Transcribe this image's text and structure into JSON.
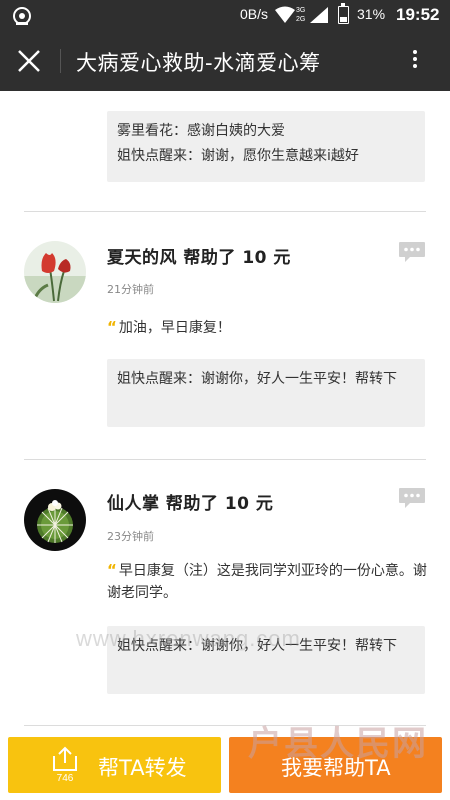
{
  "status_bar": {
    "speed": "0B/s",
    "network": "3G",
    "network2": "2G",
    "battery": "31%",
    "time": "19:52",
    "battery_level": 0.31
  },
  "header": {
    "title": "大病爱心救助-水滴爱心筹",
    "close_icon": "close-icon",
    "more_icon": "more-vertical-icon"
  },
  "top_reply": {
    "lines": [
      "雾里看花：感谢白姨的大爱",
      "姐快点醒来：谢谢，愿你生意越来i越好"
    ]
  },
  "entries": [
    {
      "name": "夏天的风 帮助了 10 元",
      "time": "21分钟前",
      "message": "加油，早日康复！",
      "reply": "姐快点醒来：谢谢你，好人一生平安！帮转下"
    },
    {
      "name": "仙人掌 帮助了 10 元",
      "time": "23分钟前",
      "message": "早日康复（注）这是我同学刘亚玲的一份心意。谢谢老同学。",
      "reply": "姐快点醒来：谢谢你，好人一生平安！帮转下"
    }
  ],
  "bottom": {
    "share_label": "帮TA转发",
    "share_count": "746",
    "help_label": "我要帮助TA"
  },
  "watermark": {
    "url": "www.hxrenwang.com",
    "logo": "户县人民网"
  },
  "colors": {
    "header_bg": "#2f2f2f",
    "share_button": "#f8c30f",
    "help_button": "#f4811f",
    "quote_mark": "#f0b400"
  }
}
